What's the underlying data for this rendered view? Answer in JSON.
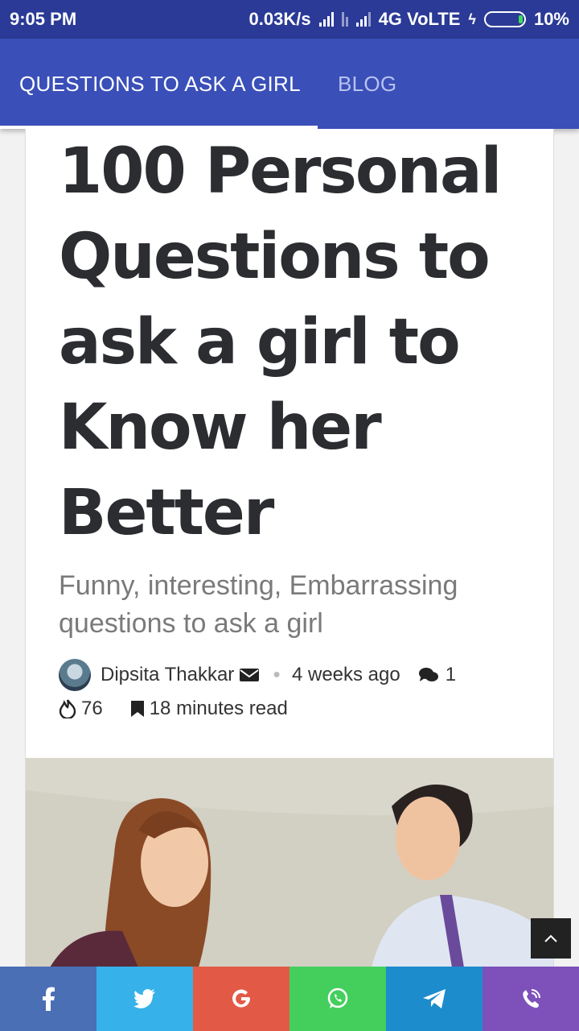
{
  "status": {
    "time": "9:05 PM",
    "speed": "0.03K/s",
    "network": "4G VoLTE",
    "battery": "10%"
  },
  "tabs": [
    {
      "label": "QUESTIONS TO ASK A GIRL",
      "active": true
    },
    {
      "label": "BLOG",
      "active": false
    }
  ],
  "article": {
    "title": "100 Personal Questions to ask a girl to Know her Better",
    "subtitle": "Funny, interesting, Embarrassing questions to ask a girl",
    "author": "Dipsita Thakkar",
    "posted": "4 weeks ago",
    "comments": "1",
    "views": "76",
    "read_time": "18 minutes read"
  },
  "share": [
    {
      "icon": "facebook-icon",
      "color": "#4a6fb5"
    },
    {
      "icon": "twitter-icon",
      "color": "#37b1e9"
    },
    {
      "icon": "google-icon",
      "color": "#e25a45"
    },
    {
      "icon": "whatsapp-icon",
      "color": "#44cf5d"
    },
    {
      "icon": "telegram-icon",
      "color": "#1c8ccd"
    },
    {
      "icon": "viber-icon",
      "color": "#7d50ba"
    }
  ],
  "colors": {
    "statusbar": "#2a3a96",
    "appbar": "#3a4fb8"
  }
}
